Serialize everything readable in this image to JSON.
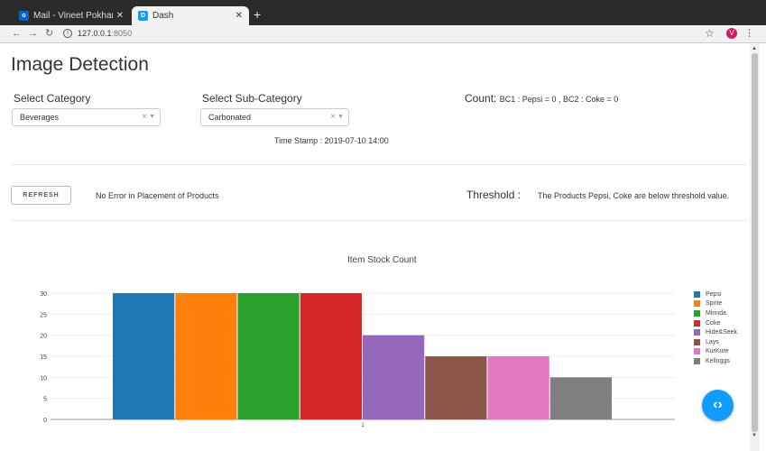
{
  "browser": {
    "tabs": [
      {
        "title": "Mail - Vineet Pokharna (U",
        "favicon": "outlook-icon",
        "favicon_text": "o",
        "active": false
      },
      {
        "title": "Dash",
        "favicon": "dash-icon",
        "favicon_text": "D",
        "active": true
      }
    ],
    "url_host": "127.0.0.1",
    "url_port": ":8050",
    "profile_initial": "V"
  },
  "page": {
    "title": "Image Detection",
    "category": {
      "label": "Select Category",
      "value": "Beverages"
    },
    "sub_category": {
      "label": "Select Sub-Category",
      "value": "Carbonated"
    },
    "count": {
      "label": "Count:",
      "value": "BC1 : Pepsi = 0 , BC2 : Coke = 0"
    },
    "timestamp": "Time Stamp : 2019-07-10 14:00",
    "refresh_label": "REFRESH",
    "error_message": "No Error in Placement of Products",
    "threshold": {
      "label": "Threshold :",
      "message": "The Products Pepsi, Coke are below threshold value."
    }
  },
  "chart_data": {
    "type": "bar",
    "title": "Item Stock Count",
    "categories": [
      "1"
    ],
    "ylim": [
      0,
      30
    ],
    "yticks": [
      0,
      5,
      10,
      15,
      20,
      25,
      30
    ],
    "grid": true,
    "legend_position": "right",
    "series": [
      {
        "name": "Pepsi",
        "values": [
          30
        ],
        "color": "#1f77b4"
      },
      {
        "name": "Sprite",
        "values": [
          30
        ],
        "color": "#ff7f0e"
      },
      {
        "name": "Mirinda",
        "values": [
          30
        ],
        "color": "#2ca02c"
      },
      {
        "name": "Coke",
        "values": [
          30
        ],
        "color": "#d62728"
      },
      {
        "name": "Hide&Seek",
        "values": [
          20
        ],
        "color": "#9467bd"
      },
      {
        "name": "Lays",
        "values": [
          15
        ],
        "color": "#8c564b"
      },
      {
        "name": "KurKure",
        "values": [
          15
        ],
        "color": "#e377c2"
      },
      {
        "name": "Kelloggs",
        "values": [
          10
        ],
        "color": "#7f7f7f"
      }
    ]
  }
}
